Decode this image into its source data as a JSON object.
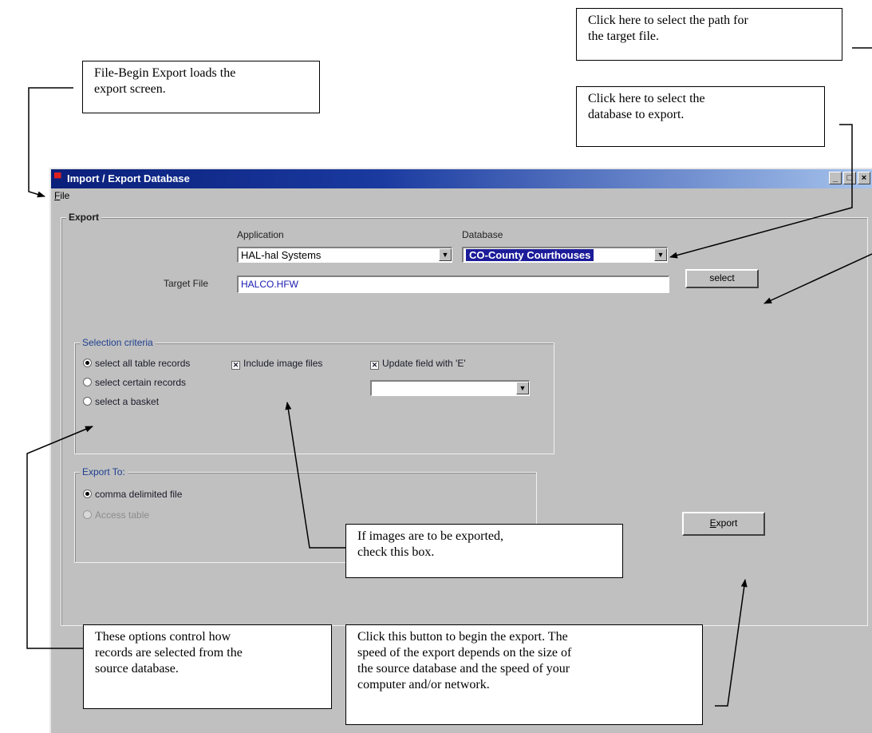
{
  "window": {
    "title": "Import / Export Database",
    "menu": {
      "file_first": "F",
      "file_rest": "ile"
    },
    "controls": [
      "_",
      "□",
      "×"
    ]
  },
  "export_group": {
    "label": "Export",
    "application_label": "Application",
    "application_value": "HAL-hal Systems",
    "database_label": "Database",
    "database_value": "CO-County Courthouses",
    "target_file_label": "Target File",
    "target_file_value": "HALCO.HFW",
    "select_button": "select",
    "export_button_first": "E",
    "export_button_rest": "xport"
  },
  "selection_criteria": {
    "label": "Selection criteria",
    "options": [
      {
        "label": "select all table records",
        "selected": true
      },
      {
        "label": "select certain records",
        "selected": false
      },
      {
        "label": "select a basket",
        "selected": false
      }
    ],
    "include_images_label": "Include image files",
    "include_images_checked": true,
    "update_field_label": "Update field with 'E'",
    "update_field_checked": true,
    "update_field_value": ""
  },
  "export_to": {
    "label": "Export To:",
    "options": [
      {
        "label": "comma delimited file",
        "selected": true,
        "enabled": true
      },
      {
        "label": "Access table",
        "selected": false,
        "enabled": false
      }
    ]
  },
  "callouts": {
    "path": "Click here to select the path for\nthe target file.",
    "begin_export": "File-Begin Export loads the\nexport screen.",
    "database": "Click here to select the\ndatabase to export.",
    "images": "If images are to be exported,\ncheck this box.",
    "options": "These options control how\nrecords are selected from the\nsource database.",
    "export_button": "Click this button to begin the export.  The\nspeed of the export depends on the size of\nthe source database and the speed of your\ncomputer and/or network."
  },
  "icons": {
    "app": "database-app-icon",
    "dropdown": "chevron-down-icon"
  }
}
